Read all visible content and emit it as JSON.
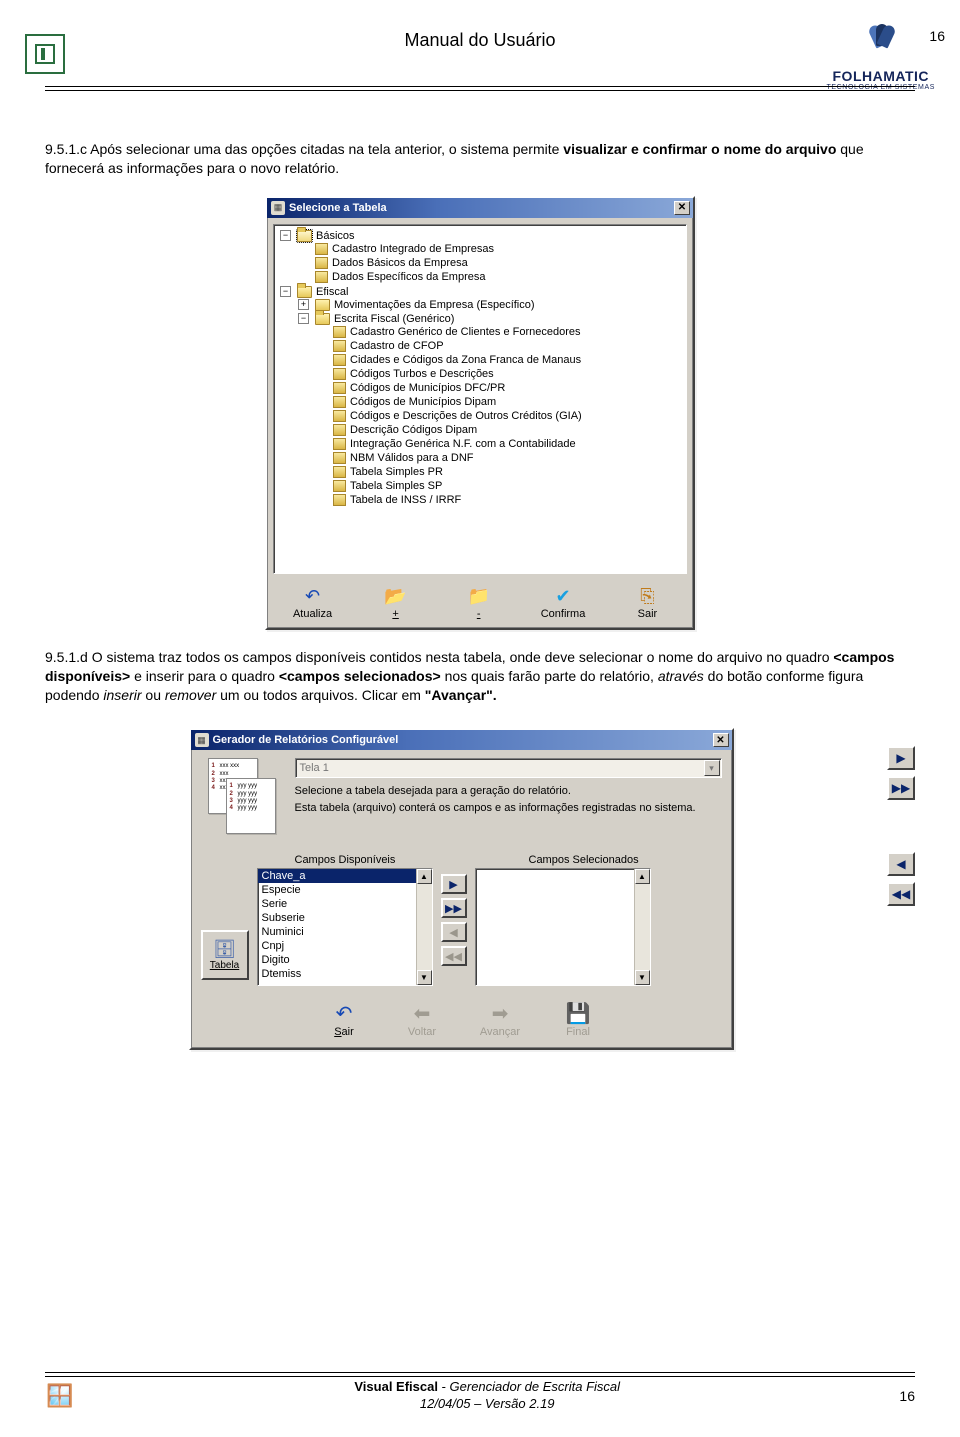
{
  "header": {
    "title": "Manual do Usuário",
    "page_number_top": "16",
    "brand": "FOLHAMATIC",
    "brand_tag": "TECNOLOGIA EM SISTEMAS"
  },
  "para1_prefix": "9.5.1.c Após selecionar uma das opções citadas na tela anterior, o sistema permite ",
  "para1_bold": "visualizar e confirmar o nome do arquivo",
  "para1_suffix": " que fornecerá as informações para o novo relatório.",
  "dlg1": {
    "title": "Selecione a Tabela",
    "root_basicos": "Básicos",
    "basicos_items": [
      "Cadastro Integrado de Empresas",
      "Dados Básicos da Empresa",
      "Dados Específicos da Empresa"
    ],
    "root_efiscal": "Efiscal",
    "efiscal_mov": "Movimentações da Empresa (Específico)",
    "efiscal_escrita": "Escrita Fiscal (Genérico)",
    "escrita_items": [
      "Cadastro Genérico de Clientes e Fornecedores",
      "Cadastro de CFOP",
      "Cidades e Códigos da Zona Franca de Manaus",
      "Códigos Turbos e Descrições",
      "Códigos de Municípios DFC/PR",
      "Códigos de Municípios Dipam",
      "Códigos e Descrições de Outros Créditos (GIA)",
      "Descrição Códigos Dipam",
      "Integração Genérica N.F. com a Contabilidade",
      "NBM Válidos para a DNF",
      "Tabela Simples PR",
      "Tabela Simples SP",
      "Tabela de INSS / IRRF"
    ],
    "btn_atualiza": "Atualiza",
    "btn_plus": "+",
    "btn_minus": "-",
    "btn_confirma": "Confirma",
    "btn_sair": "Sair"
  },
  "para2_prefix": "9.5.1.d O sistema traz todos os campos disponíveis contidos nesta tabela, onde deve selecionar o nome do arquivo no quadro ",
  "para2_b1": "<campos disponíveis>",
  "para2_mid": " e inserir para o quadro ",
  "para2_b2": "<campos selecionados>",
  "para2_mid2": " nos quais farão parte do relatório, ",
  "para2_it": "através",
  "para2_mid3": " do botão conforme figura podendo ",
  "para2_it2": "inserir",
  "para2_mid4": " ou ",
  "para2_it3": "remover",
  "para2_mid5": " um ou todos arquivos. Clicar em ",
  "para2_b3": "\"Avançar\".",
  "dlg2": {
    "title": "Gerador de Relatórios Configurável",
    "combo_value": "Tela 1",
    "desc_l1": "Selecione a tabela desejada para a geração do relatório.",
    "desc_l2": "Esta tabela (arquivo) conterá os campos e as informações registradas no sistema.",
    "lbl_disp": "Campos Disponíveis",
    "lbl_sel": "Campos Selecionados",
    "disp_items": [
      "Chave_a",
      "Especie",
      "Serie",
      "Subserie",
      "Numinici",
      "Cnpj",
      "Digito",
      "Dtemiss"
    ],
    "side_btn_label": "Tabela",
    "btn_sair": "Sair",
    "btn_voltar": "Voltar",
    "btn_avancar": "Avançar",
    "btn_final": "Final"
  },
  "footer": {
    "line1_a": "Visual Efiscal",
    "line1_b": " - ",
    "line1_c": "Gerenciador de Escrita Fiscal",
    "line2": "12/04/05 – Versão 2.19",
    "page": "16"
  }
}
